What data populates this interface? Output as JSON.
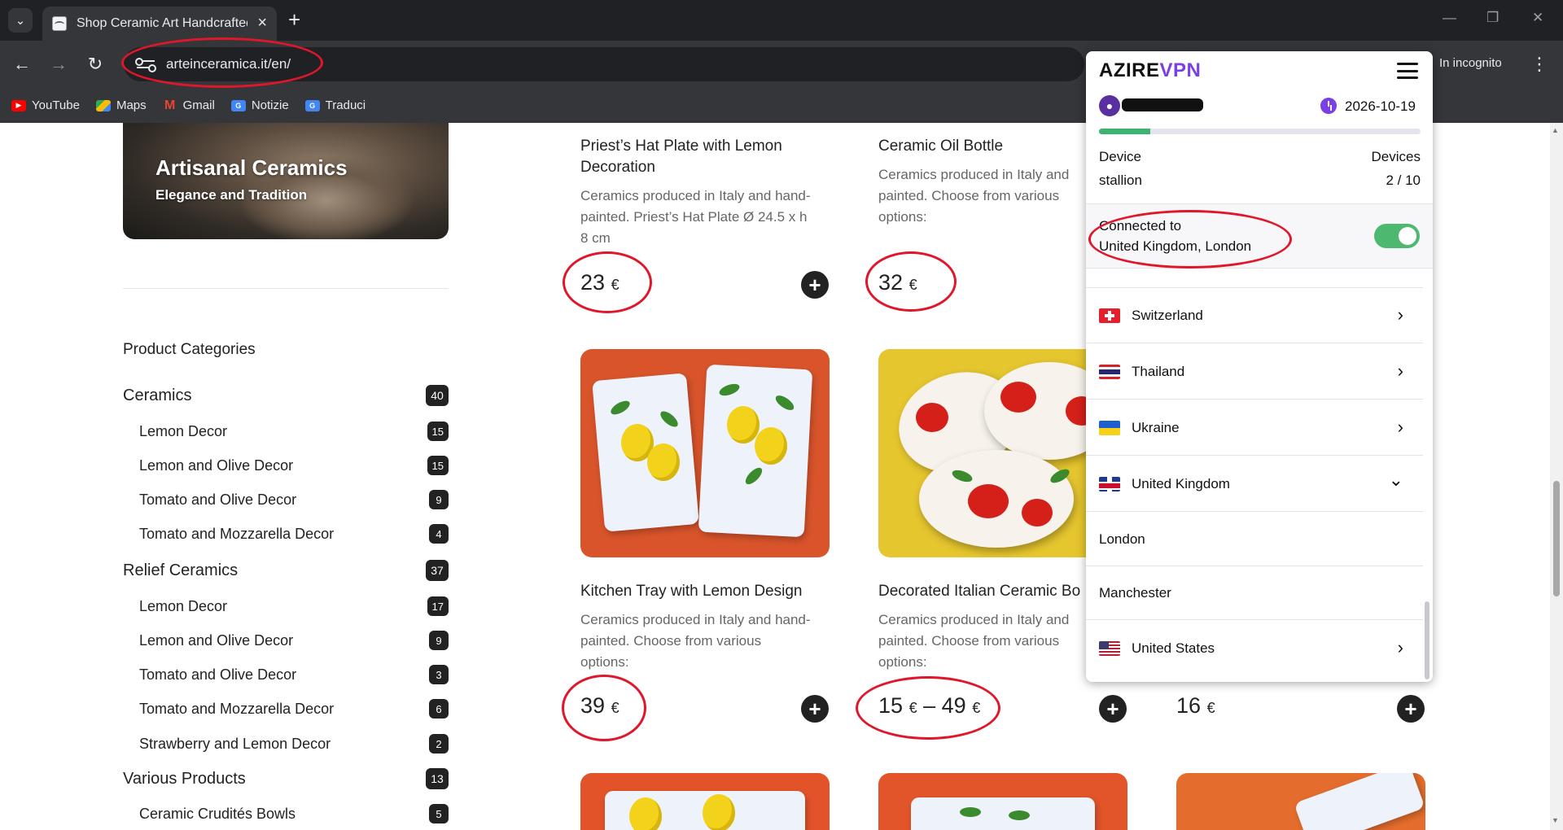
{
  "browser": {
    "tab_title": "Shop Ceramic Art Handcrafted C",
    "url": "arteinceramica.it/en/",
    "incognito_label": "In incognito",
    "bookmarks": [
      {
        "label": "YouTube",
        "icon": "youtube-icon"
      },
      {
        "label": "Maps",
        "icon": "maps-icon"
      },
      {
        "label": "Gmail",
        "icon": "gmail-icon"
      },
      {
        "label": "Notizie",
        "icon": "news-icon"
      },
      {
        "label": "Traduci",
        "icon": "translate-icon"
      }
    ]
  },
  "hero": {
    "title": "Artisanal Ceramics",
    "subtitle": "Elegance and Tradition"
  },
  "categories": {
    "heading": "Product Categories",
    "items": [
      {
        "label": "Ceramics",
        "count": "40",
        "level": "top"
      },
      {
        "label": "Lemon Decor",
        "count": "15",
        "level": "sub"
      },
      {
        "label": "Lemon and Olive Decor",
        "count": "15",
        "level": "sub"
      },
      {
        "label": "Tomato and Olive Decor",
        "count": "9",
        "level": "sub"
      },
      {
        "label": "Tomato and Mozzarella Decor",
        "count": "4",
        "level": "sub"
      },
      {
        "label": "Relief Ceramics",
        "count": "37",
        "level": "top"
      },
      {
        "label": "Lemon Decor",
        "count": "17",
        "level": "sub"
      },
      {
        "label": "Lemon and Olive Decor",
        "count": "9",
        "level": "sub"
      },
      {
        "label": "Tomato and Olive Decor",
        "count": "3",
        "level": "sub"
      },
      {
        "label": "Tomato and Mozzarella Decor",
        "count": "6",
        "level": "sub"
      },
      {
        "label": "Strawberry and Lemon Decor",
        "count": "2",
        "level": "sub"
      },
      {
        "label": "Various Products",
        "count": "13",
        "level": "top"
      },
      {
        "label": "Ceramic Crudités Bowls",
        "count": "5",
        "level": "sub"
      }
    ]
  },
  "products": {
    "p1": {
      "title_line1": "Priest’s Hat Plate with Lemon",
      "title_line2": "Decoration",
      "desc_line1": "Ceramics produced in Italy and hand-",
      "desc_line2": "painted. Priest’s Hat Plate Ø 24.5 x h",
      "desc_line3": "8 cm",
      "price": "23",
      "currency": "€"
    },
    "p2": {
      "title": "Ceramic Oil Bottle",
      "desc_line1": "Ceramics produced in Italy and",
      "desc_line2": "painted. Choose from various",
      "desc_line3": "options:",
      "price": "32",
      "currency": "€"
    },
    "p3": {
      "title": "Kitchen Tray with Lemon Design",
      "desc_line1": "Ceramics produced in Italy and hand-",
      "desc_line2": "painted. Choose from various",
      "desc_line3": "options:",
      "price": "39",
      "currency": "€"
    },
    "p4": {
      "title": "Decorated Italian Ceramic Bo",
      "desc_line1": "Ceramics produced in Italy and",
      "desc_line2": "painted. Choose from various",
      "desc_line3": "options:",
      "price_min": "15",
      "price_sep": "–",
      "price_max": "49",
      "currency": "€"
    },
    "p5": {
      "price": "16",
      "currency": "€"
    }
  },
  "vpn": {
    "logo_part1": "AZIRE",
    "logo_part2": "VPN",
    "avatar_icon": "cat-avatar-icon",
    "expiry_date": "2026-10-19",
    "usage_fraction": 0.16,
    "device_label": "Device",
    "device_name": "stallion",
    "devices_label": "Devices",
    "devices_count": "2 / 10",
    "status_line1": "Connected to",
    "status_line2": "United Kingdom, London",
    "locations": [
      {
        "name": "Switzerland",
        "flag": "flag-switzerland-icon",
        "chevron": "›"
      },
      {
        "name": "Thailand",
        "flag": "flag-thailand-icon",
        "chevron": "›"
      },
      {
        "name": "Ukraine",
        "flag": "flag-ukraine-icon",
        "chevron": "›"
      },
      {
        "name": "United Kingdom",
        "flag": "flag-uk-icon",
        "chevron": "⌄"
      }
    ],
    "uk_cities": [
      "London",
      "Manchester"
    ],
    "last_location": {
      "name": "United States",
      "flag": "flag-us-icon",
      "chevron": "›"
    }
  },
  "colors": {
    "vpn_accent": "#7b3fe4",
    "toggle_on": "#4cb870",
    "annotation_red": "#e0162b"
  }
}
